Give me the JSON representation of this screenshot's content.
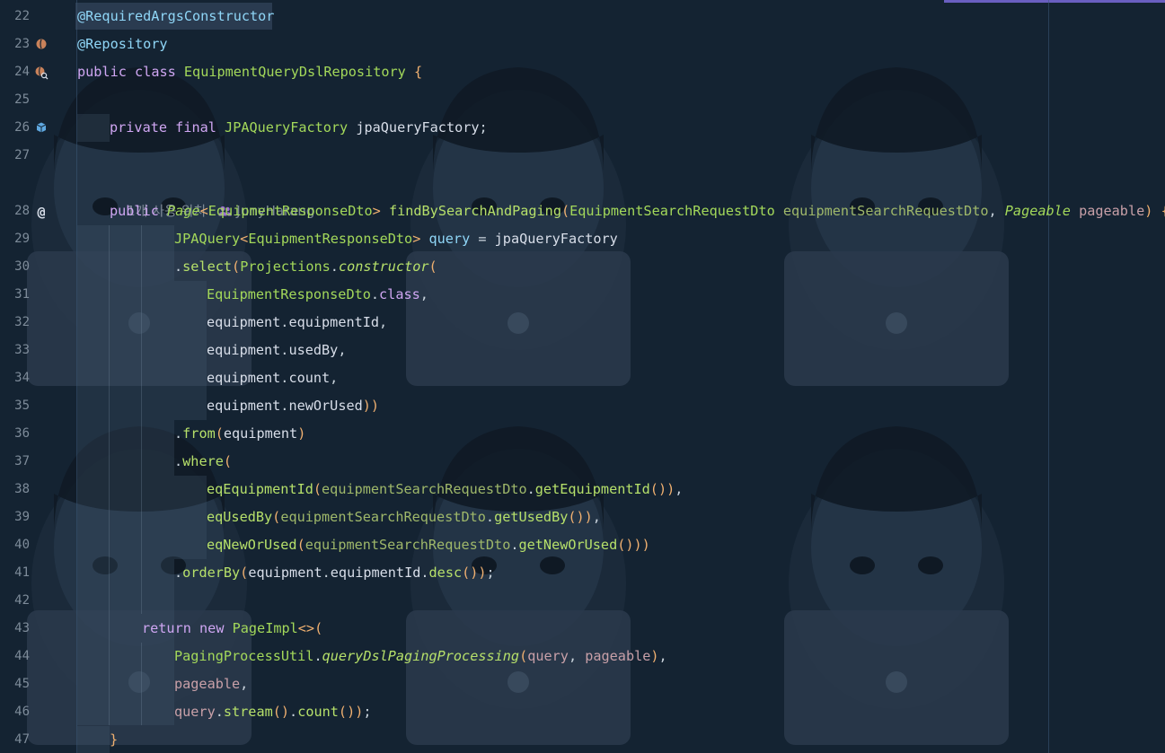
{
  "editor": {
    "colors": {
      "background": "#142332",
      "keyword": "#cfa6f2",
      "type": "#a3d85a",
      "annotation": "#8fd6f7",
      "method": "#b6e06a",
      "line_number": "#7d8b99",
      "tab_indicator": "#6a5fc1"
    },
    "gutter_icons": {
      "23": "bean-icon",
      "24": "bean-search-icon",
      "26": "injection-icon",
      "28": "at-sign-icon"
    },
    "inlay_hint": {
      "usages": "1개 사용 위치",
      "author_icon": "people-icon",
      "author": "JunyHarang"
    },
    "line_numbers": [
      "22",
      "23",
      "24",
      "25",
      "26",
      "27",
      "28",
      "29",
      "30",
      "31",
      "32",
      "33",
      "34",
      "35",
      "36",
      "37",
      "38",
      "39",
      "40",
      "41",
      "42",
      "43",
      "44",
      "45",
      "46",
      "47"
    ],
    "lines": [
      {
        "n": "22",
        "indent": 0,
        "tokens": [
          [
            "@RequiredArgsConstructor",
            "ann"
          ]
        ]
      },
      {
        "n": "23",
        "indent": 0,
        "tokens": [
          [
            "@Repository",
            "ann"
          ]
        ]
      },
      {
        "n": "24",
        "indent": 0,
        "tokens": [
          [
            "public",
            "kw"
          ],
          [
            " ",
            "id"
          ],
          [
            "class",
            "kw"
          ],
          [
            " ",
            "id"
          ],
          [
            "EquipmentQueryDslRepository",
            "ty"
          ],
          [
            " ",
            "id"
          ],
          [
            "{",
            "pb"
          ]
        ]
      },
      {
        "n": "25",
        "indent": 0,
        "tokens": []
      },
      {
        "n": "26",
        "indent": 1,
        "tokens": [
          [
            "private",
            "kw"
          ],
          [
            " ",
            "id"
          ],
          [
            "final",
            "kw"
          ],
          [
            " ",
            "id"
          ],
          [
            "JPAQueryFactory",
            "ty"
          ],
          [
            " ",
            "id"
          ],
          [
            "jpaQueryFactory",
            "id"
          ],
          [
            ";",
            "op"
          ]
        ]
      },
      {
        "n": "27",
        "indent": 0,
        "tokens": []
      },
      {
        "n": "28",
        "indent": 1,
        "tokens": [
          [
            "public",
            "kw"
          ],
          [
            " ",
            "id"
          ],
          [
            "Page",
            "ty it"
          ],
          [
            "<",
            "pb"
          ],
          [
            "EquipmentResponseDto",
            "ty"
          ],
          [
            ">",
            "pb"
          ],
          [
            " ",
            "id"
          ],
          [
            "findBySearchAndPaging",
            "fn"
          ],
          [
            "(",
            "pb"
          ],
          [
            "EquipmentSearchRequestDto",
            "ty"
          ],
          [
            " ",
            "id"
          ],
          [
            "equipmentSearchRequestDto",
            "pm"
          ],
          [
            ", ",
            "op"
          ],
          [
            "Pageable",
            "ty it"
          ],
          [
            " ",
            "id"
          ],
          [
            "pageable",
            "pa"
          ],
          [
            ")",
            "pb"
          ],
          [
            " ",
            "id"
          ],
          [
            "{",
            "pb"
          ]
        ]
      },
      {
        "n": "29",
        "indent": 3,
        "tokens": [
          [
            "JPAQuery",
            "ty"
          ],
          [
            "<",
            "pb"
          ],
          [
            "EquipmentResponseDto",
            "ty"
          ],
          [
            ">",
            "pb"
          ],
          [
            " ",
            "id"
          ],
          [
            "query",
            "ann"
          ],
          [
            " = ",
            "op"
          ],
          [
            "jpaQueryFactory",
            "id"
          ]
        ]
      },
      {
        "n": "30",
        "indent": 3,
        "tokens": [
          [
            ".",
            "op"
          ],
          [
            "select",
            "fn"
          ],
          [
            "(",
            "pb"
          ],
          [
            "Projections",
            "ty"
          ],
          [
            ".",
            "op"
          ],
          [
            "constructor",
            "fn it"
          ],
          [
            "(",
            "pb"
          ]
        ]
      },
      {
        "n": "31",
        "indent": 4,
        "tokens": [
          [
            "EquipmentResponseDto",
            "ty"
          ],
          [
            ".",
            "op"
          ],
          [
            "class",
            "kw"
          ],
          [
            ",",
            "op"
          ]
        ]
      },
      {
        "n": "32",
        "indent": 4,
        "tokens": [
          [
            "equipment",
            "id"
          ],
          [
            ".",
            "op"
          ],
          [
            "equipmentId",
            "id"
          ],
          [
            ",",
            "op"
          ]
        ]
      },
      {
        "n": "33",
        "indent": 4,
        "tokens": [
          [
            "equipment",
            "id"
          ],
          [
            ".",
            "op"
          ],
          [
            "usedBy",
            "id"
          ],
          [
            ",",
            "op"
          ]
        ]
      },
      {
        "n": "34",
        "indent": 4,
        "tokens": [
          [
            "equipment",
            "id"
          ],
          [
            ".",
            "op"
          ],
          [
            "count",
            "id"
          ],
          [
            ",",
            "op"
          ]
        ]
      },
      {
        "n": "35",
        "indent": 4,
        "tokens": [
          [
            "equipment",
            "id"
          ],
          [
            ".",
            "op"
          ],
          [
            "newOrUsed",
            "id"
          ],
          [
            "))",
            "pb"
          ]
        ]
      },
      {
        "n": "36",
        "indent": 3,
        "tokens": [
          [
            ".",
            "op"
          ],
          [
            "from",
            "fn"
          ],
          [
            "(",
            "pb"
          ],
          [
            "equipment",
            "id"
          ],
          [
            ")",
            "pb"
          ]
        ]
      },
      {
        "n": "37",
        "indent": 3,
        "tokens": [
          [
            ".",
            "op"
          ],
          [
            "where",
            "fn"
          ],
          [
            "(",
            "pb"
          ]
        ]
      },
      {
        "n": "38",
        "indent": 4,
        "tokens": [
          [
            "eqEquipmentId",
            "fn"
          ],
          [
            "(",
            "pb"
          ],
          [
            "equipmentSearchRequestDto",
            "pm"
          ],
          [
            ".",
            "op"
          ],
          [
            "getEquipmentId",
            "fn"
          ],
          [
            "())",
            "pb"
          ],
          [
            ",",
            "op"
          ]
        ]
      },
      {
        "n": "39",
        "indent": 4,
        "tokens": [
          [
            "eqUsedBy",
            "fn"
          ],
          [
            "(",
            "pb"
          ],
          [
            "equipmentSearchRequestDto",
            "pm"
          ],
          [
            ".",
            "op"
          ],
          [
            "getUsedBy",
            "fn"
          ],
          [
            "())",
            "pb"
          ],
          [
            ",",
            "op"
          ]
        ]
      },
      {
        "n": "40",
        "indent": 4,
        "tokens": [
          [
            "eqNewOrUsed",
            "fn"
          ],
          [
            "(",
            "pb"
          ],
          [
            "equipmentSearchRequestDto",
            "pm"
          ],
          [
            ".",
            "op"
          ],
          [
            "getNewOrUsed",
            "fn"
          ],
          [
            "()))",
            "pb"
          ]
        ]
      },
      {
        "n": "41",
        "indent": 3,
        "tokens": [
          [
            ".",
            "op"
          ],
          [
            "orderBy",
            "fn"
          ],
          [
            "(",
            "pb"
          ],
          [
            "equipment",
            "id"
          ],
          [
            ".",
            "op"
          ],
          [
            "equipmentId",
            "id"
          ],
          [
            ".",
            "op"
          ],
          [
            "desc",
            "fn"
          ],
          [
            "())",
            "pb"
          ],
          [
            ";",
            "op"
          ]
        ]
      },
      {
        "n": "42",
        "indent": 0,
        "tokens": []
      },
      {
        "n": "43",
        "indent": 2,
        "tokens": [
          [
            "return",
            "kw"
          ],
          [
            " ",
            "id"
          ],
          [
            "new",
            "kw"
          ],
          [
            " ",
            "id"
          ],
          [
            "PageImpl",
            "ty"
          ],
          [
            "<>(",
            "pb"
          ]
        ]
      },
      {
        "n": "44",
        "indent": 3,
        "tokens": [
          [
            "PagingProcessUtil",
            "ty"
          ],
          [
            ".",
            "op"
          ],
          [
            "queryDslPagingProcessing",
            "fn it"
          ],
          [
            "(",
            "pb"
          ],
          [
            "query",
            "pa"
          ],
          [
            ", ",
            "op"
          ],
          [
            "pageable",
            "pa"
          ],
          [
            ")",
            "pb"
          ],
          [
            ",",
            "op"
          ]
        ]
      },
      {
        "n": "45",
        "indent": 3,
        "tokens": [
          [
            "pageable",
            "pa"
          ],
          [
            ",",
            "op"
          ]
        ]
      },
      {
        "n": "46",
        "indent": 3,
        "tokens": [
          [
            "query",
            "pa"
          ],
          [
            ".",
            "op"
          ],
          [
            "stream",
            "fn"
          ],
          [
            "()",
            "pb"
          ],
          [
            ".",
            "op"
          ],
          [
            "count",
            "fn"
          ],
          [
            "())",
            "pb"
          ],
          [
            ";",
            "op"
          ]
        ]
      },
      {
        "n": "47",
        "indent": 1,
        "tokens": [
          [
            "}",
            "pb"
          ]
        ]
      }
    ]
  }
}
